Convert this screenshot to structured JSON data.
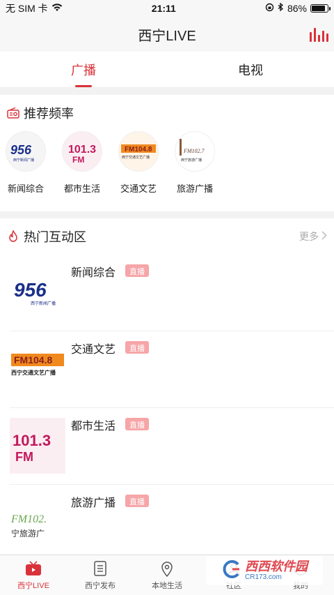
{
  "status": {
    "carrier": "无 SIM 卡",
    "time": "21:11",
    "battery": "86%",
    "battery_level": 0.86
  },
  "header": {
    "title": "西宁LIVE"
  },
  "tabs": [
    {
      "label": "广播",
      "active": true
    },
    {
      "label": "电视",
      "active": false
    }
  ],
  "recommend": {
    "title": "推荐频率",
    "channels": [
      {
        "name": "新闻综合",
        "logo_text": "956",
        "logo_sub": "西宁新闻广播"
      },
      {
        "name": "都市生活",
        "logo_text": "101.3",
        "logo_sub": "FM"
      },
      {
        "name": "交通文艺",
        "logo_text": "FM104.8",
        "logo_sub": "西宁交通文艺广播"
      },
      {
        "name": "旅游广播",
        "logo_text": "FM102.7",
        "logo_sub": "西宁旅游广播"
      }
    ]
  },
  "hot": {
    "title": "热门互动区",
    "more": "更多",
    "items": [
      {
        "title": "新闻综合",
        "badge": "直播",
        "logo_text": "956",
        "logo_sub": "西宁新闻广播"
      },
      {
        "title": "交通文艺",
        "badge": "直播",
        "logo_text": "FM104.8",
        "logo_sub": "西宁交通文艺广播"
      },
      {
        "title": "都市生活",
        "badge": "直播",
        "logo_text": "101.3",
        "logo_sub": "FM"
      },
      {
        "title": "旅游广播",
        "badge": "直播",
        "logo_text": "FM102.",
        "logo_sub": "宁旅游广"
      }
    ]
  },
  "tabbar": [
    {
      "label": "西宁LIVE",
      "icon": "tv-icon",
      "active": true
    },
    {
      "label": "西宁发布",
      "icon": "document-icon",
      "active": false
    },
    {
      "label": "本地生活",
      "icon": "location-icon",
      "active": false
    },
    {
      "label": "社区",
      "icon": "community-icon",
      "active": false
    },
    {
      "label": "我的",
      "icon": "profile-icon",
      "active": false
    }
  ],
  "watermark": {
    "main": "西西软件园",
    "sub": "CR173.com"
  },
  "colors": {
    "accent": "#d9323a",
    "badge": "#f6a5a8"
  }
}
